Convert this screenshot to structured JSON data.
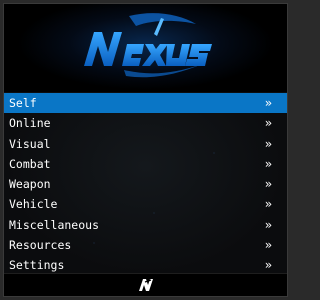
{
  "header": {
    "logo_text": "NEXUS"
  },
  "menu": {
    "selected_index": 0,
    "chevron": "»",
    "items": [
      {
        "label": "Self"
      },
      {
        "label": "Online"
      },
      {
        "label": "Visual"
      },
      {
        "label": "Combat"
      },
      {
        "label": "Weapon"
      },
      {
        "label": "Vehicle"
      },
      {
        "label": "Miscellaneous"
      },
      {
        "label": "Resources"
      },
      {
        "label": "Settings"
      }
    ]
  },
  "footer": {
    "icon": "nexus-n-icon"
  },
  "colors": {
    "accent": "#0a76c6",
    "background": "#0b0c0e",
    "logo_blue": "#1a8cff"
  }
}
